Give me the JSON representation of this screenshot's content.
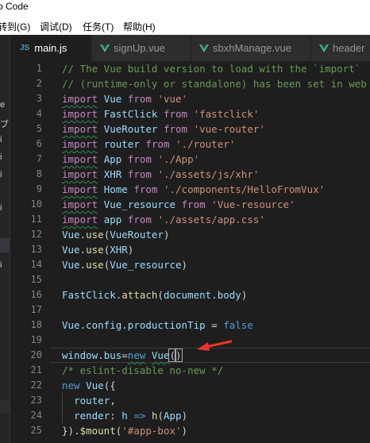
{
  "window": {
    "title": "o Code"
  },
  "menu": [
    {
      "label": "转到(G)"
    },
    {
      "label": "调试(D)"
    },
    {
      "label": "任务(T)"
    },
    {
      "label": "帮助(H)"
    }
  ],
  "sidebar": {
    "fragments": [
      "e",
      "ブ",
      "i",
      "i",
      "i",
      "i",
      "i"
    ]
  },
  "tabs": [
    {
      "label": "main.js",
      "icon": "js-file-icon",
      "active": true
    },
    {
      "label": "signUp.vue",
      "icon": "vue-file-icon",
      "active": false
    },
    {
      "label": "sbxhManage.vue",
      "icon": "vue-file-icon",
      "active": false
    },
    {
      "label": "header",
      "icon": "vue-file-icon",
      "active": false
    }
  ],
  "editor": {
    "line_numbers": [
      "1",
      "2",
      "3",
      "4",
      "5",
      "6",
      "7",
      "8",
      "9",
      "10",
      "11",
      "12",
      "13",
      "14",
      "15",
      "16",
      "17",
      "18",
      "19",
      "20",
      "21",
      "22",
      "23",
      "24",
      "25"
    ],
    "lines": [
      [
        [
          "cm",
          "// The Vue build version to load with the `import`"
        ]
      ],
      [
        [
          "cm",
          "// (runtime-only or standalone) has been set in web"
        ]
      ],
      [
        [
          "kw",
          "import",
          1
        ],
        [
          "pl",
          " "
        ],
        [
          "id",
          "Vue"
        ],
        [
          "pl",
          " "
        ],
        [
          "kw",
          "from"
        ],
        [
          "pl",
          " "
        ],
        [
          "str",
          "'vue'"
        ]
      ],
      [
        [
          "kw",
          "import",
          1
        ],
        [
          "pl",
          " "
        ],
        [
          "id",
          "FastClick"
        ],
        [
          "pl",
          " "
        ],
        [
          "kw",
          "from"
        ],
        [
          "pl",
          " "
        ],
        [
          "str",
          "'fastclick'"
        ]
      ],
      [
        [
          "kw",
          "import",
          1
        ],
        [
          "pl",
          " "
        ],
        [
          "id",
          "VueRouter"
        ],
        [
          "pl",
          " "
        ],
        [
          "kw",
          "from"
        ],
        [
          "pl",
          " "
        ],
        [
          "str",
          "'vue-router'"
        ]
      ],
      [
        [
          "kw",
          "import",
          1
        ],
        [
          "pl",
          " "
        ],
        [
          "id",
          "router"
        ],
        [
          "pl",
          " "
        ],
        [
          "kw",
          "from"
        ],
        [
          "pl",
          " "
        ],
        [
          "str",
          "'./router'"
        ]
      ],
      [
        [
          "kw",
          "import",
          1
        ],
        [
          "pl",
          " "
        ],
        [
          "id",
          "App"
        ],
        [
          "pl",
          " "
        ],
        [
          "kw",
          "from"
        ],
        [
          "pl",
          " "
        ],
        [
          "str",
          "'./App'"
        ]
      ],
      [
        [
          "kw",
          "import",
          1
        ],
        [
          "pl",
          " "
        ],
        [
          "id",
          "XHR"
        ],
        [
          "pl",
          " "
        ],
        [
          "kw",
          "from"
        ],
        [
          "pl",
          " "
        ],
        [
          "str",
          "'./assets/js/xhr'"
        ]
      ],
      [
        [
          "kw",
          "import",
          1
        ],
        [
          "pl",
          " "
        ],
        [
          "id",
          "Home"
        ],
        [
          "pl",
          " "
        ],
        [
          "kw",
          "from"
        ],
        [
          "pl",
          " "
        ],
        [
          "str",
          "'./components/HelloFromVux'"
        ]
      ],
      [
        [
          "kw",
          "import",
          1
        ],
        [
          "pl",
          " "
        ],
        [
          "id",
          "Vue_resource"
        ],
        [
          "pl",
          " "
        ],
        [
          "kw",
          "from"
        ],
        [
          "pl",
          " "
        ],
        [
          "str",
          "'Vue-resource'"
        ]
      ],
      [
        [
          "kw",
          "import",
          1
        ],
        [
          "pl",
          " "
        ],
        [
          "id",
          "app"
        ],
        [
          "pl",
          " "
        ],
        [
          "kw",
          "from"
        ],
        [
          "pl",
          " "
        ],
        [
          "str",
          "'./assets/app.css'"
        ]
      ],
      [
        [
          "id",
          "Vue"
        ],
        [
          "pl",
          "."
        ],
        [
          "fn",
          "use"
        ],
        [
          "pl",
          "("
        ],
        [
          "id",
          "VueRouter"
        ],
        [
          "pl",
          ")"
        ]
      ],
      [
        [
          "id",
          "Vue"
        ],
        [
          "pl",
          "."
        ],
        [
          "fn",
          "use"
        ],
        [
          "pl",
          "("
        ],
        [
          "id",
          "XHR"
        ],
        [
          "pl",
          ")"
        ]
      ],
      [
        [
          "id",
          "Vue"
        ],
        [
          "pl",
          "."
        ],
        [
          "fn",
          "use"
        ],
        [
          "pl",
          "("
        ],
        [
          "id",
          "Vue_resource"
        ],
        [
          "pl",
          ")"
        ]
      ],
      [],
      [
        [
          "id",
          "FastClick"
        ],
        [
          "pl",
          "."
        ],
        [
          "fn",
          "attach"
        ],
        [
          "pl",
          "("
        ],
        [
          "id",
          "document"
        ],
        [
          "pl",
          "."
        ],
        [
          "id",
          "body"
        ],
        [
          "pl",
          ")"
        ]
      ],
      [],
      [
        [
          "id",
          "Vue"
        ],
        [
          "pl",
          "."
        ],
        [
          "id",
          "config"
        ],
        [
          "pl",
          "."
        ],
        [
          "id",
          "productionTip"
        ],
        [
          "pl",
          " = "
        ],
        [
          "kwb",
          "false"
        ]
      ],
      [],
      [
        [
          "id",
          "window"
        ],
        [
          "pl",
          "."
        ],
        [
          "id",
          "bus"
        ],
        [
          "pl",
          "="
        ],
        [
          "kwb",
          "new",
          1
        ],
        [
          "pl",
          " "
        ],
        [
          "id",
          "Vue",
          1
        ],
        [
          "pl",
          "(",
          2
        ],
        [
          "pl",
          ")",
          2
        ]
      ],
      [
        [
          "cm",
          "/* eslint-disable no-new */"
        ]
      ],
      [
        [
          "kwb",
          "new"
        ],
        [
          "pl",
          " "
        ],
        [
          "id",
          "Vue"
        ],
        [
          "pl",
          "({"
        ]
      ],
      [
        [
          "pl",
          "  "
        ],
        [
          "id",
          "router"
        ],
        [
          "pl",
          ","
        ]
      ],
      [
        [
          "pl",
          "  "
        ],
        [
          "id",
          "render"
        ],
        [
          "pl",
          ": "
        ],
        [
          "id",
          "h"
        ],
        [
          "pl",
          " "
        ],
        [
          "kwb",
          "=>"
        ],
        [
          "pl",
          " "
        ],
        [
          "fn",
          "h"
        ],
        [
          "pl",
          "("
        ],
        [
          "id",
          "App"
        ],
        [
          "pl",
          ")"
        ]
      ],
      [
        [
          "pl",
          "})."
        ],
        [
          "fn",
          "$mount"
        ],
        [
          "pl",
          "("
        ],
        [
          "str",
          "'#app-box'"
        ],
        [
          "pl",
          ")"
        ]
      ]
    ]
  },
  "colors": {
    "editor_bg": "#1e1e1e",
    "comment": "#6a9955",
    "keyword": "#c586c0",
    "string": "#ce9178",
    "identifier": "#9cdcfe",
    "annotation_arrow": "#e8352c"
  }
}
